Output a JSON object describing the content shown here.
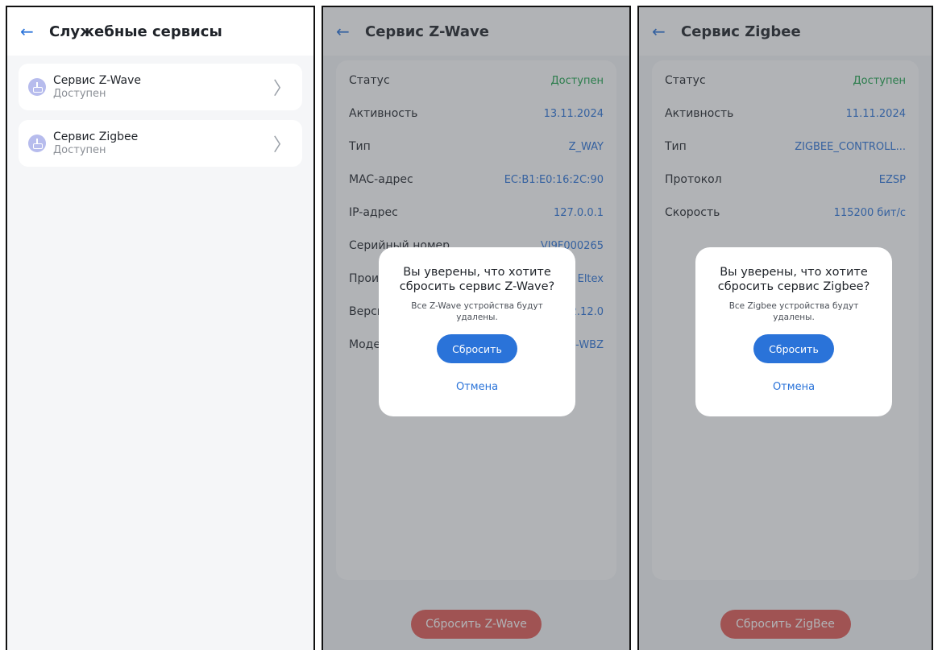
{
  "screen1": {
    "title": "Служебные сервисы",
    "services": [
      {
        "name": "Сервис Z-Wave",
        "status": "Доступен"
      },
      {
        "name": "Сервис Zigbee",
        "status": "Доступен"
      }
    ]
  },
  "screen2": {
    "title": "Сервис Z-Wave",
    "rows": [
      {
        "label": "Статус",
        "value": "Доступен"
      },
      {
        "label": "Активность",
        "value": "13.11.2024"
      },
      {
        "label": "Тип",
        "value": "Z_WAY"
      },
      {
        "label": "MAC-адрес",
        "value": "EC:B1:E0:16:2C:90"
      },
      {
        "label": "IP-адрес",
        "value": "127.0.0.1"
      },
      {
        "label": "Серийный номер",
        "value": "VI9F000265"
      },
      {
        "label": "Прои",
        "value": "Eltex"
      },
      {
        "label": "Верси",
        "value": "2.12.0"
      },
      {
        "label": "Моде",
        "value": "-WBZ"
      }
    ],
    "bottom_button": "Сбросить Z-Wave",
    "dialog": {
      "title": "Вы уверены, что хотите сбросить сервис Z-Wave?",
      "subtitle": "Все Z-Wave устройства будут удалены.",
      "confirm": "Сбросить",
      "cancel": "Отмена"
    }
  },
  "screen3": {
    "title": "Сервис Zigbee",
    "rows": [
      {
        "label": "Статус",
        "value": "Доступен"
      },
      {
        "label": "Активность",
        "value": "11.11.2024"
      },
      {
        "label": "Тип",
        "value": "ZIGBEE_CONTROLL..."
      },
      {
        "label": "Протокол",
        "value": "EZSP"
      },
      {
        "label": "Скорость",
        "value": "115200 бит/с"
      }
    ],
    "bottom_button": "Сбросить ZigBee",
    "dialog": {
      "title": "Вы уверены, что хотите сбросить сервис Zigbee?",
      "subtitle": "Все Zigbee устройства будут удалены.",
      "confirm": "Сбросить",
      "cancel": "Отмена"
    }
  },
  "colors": {
    "accent": "#2a73d9",
    "status_available": "#1ba34a",
    "danger": "#e25a55",
    "icon_bg": "#b7bced"
  },
  "icons": {
    "back": "arrow-left-icon",
    "chevron": "chevron-right-icon",
    "service": "router-icon"
  }
}
